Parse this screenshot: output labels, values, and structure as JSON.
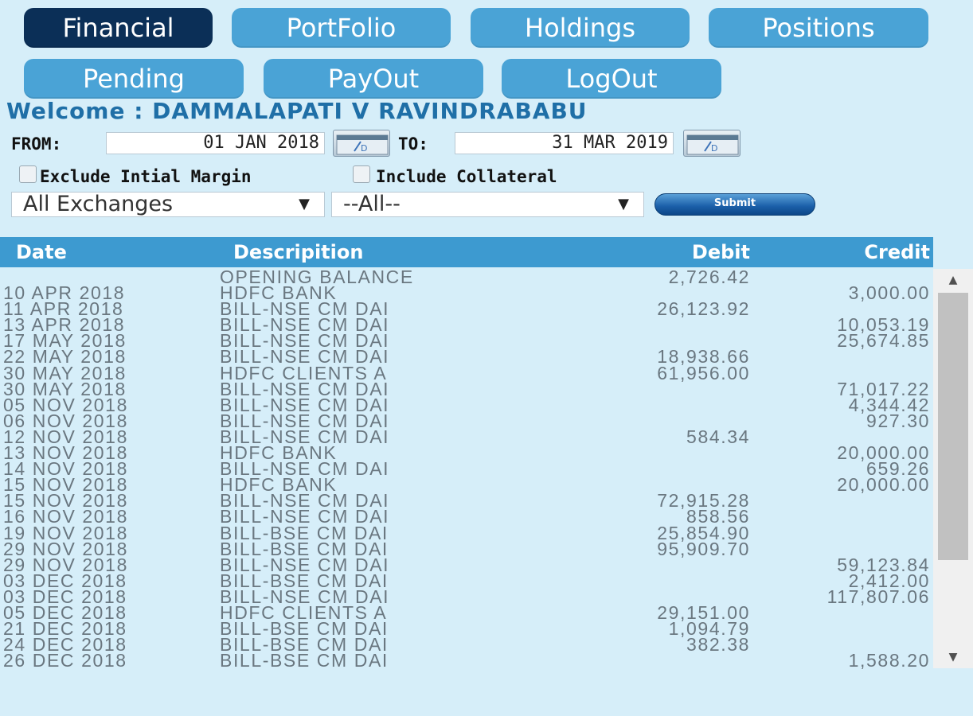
{
  "nav": {
    "financial": "Financial",
    "portfolio": "PortFolio",
    "holdings": "Holdings",
    "positions": "Positions",
    "pending": "Pending",
    "payout": "PayOut",
    "logout": "LogOut"
  },
  "welcome": "Welcome : DAMMALAPATI V RAVINDRABABU",
  "filters": {
    "from_label": "FROM:",
    "from_value": "01 JAN 2018",
    "to_label": "TO:",
    "to_value": "31 MAR 2019",
    "exclude_margin": "Exclude Intial Margin",
    "include_collateral": "Include Collateral",
    "exchange_select": "All Exchanges",
    "segment_select": "--All--",
    "submit": "Submit"
  },
  "table": {
    "headers": {
      "date": "Date",
      "description": "Descripition",
      "debit": "Debit",
      "credit": "Credit"
    },
    "rows": [
      {
        "date": "",
        "desc": "OPENING BALANCE",
        "debit": "2,726.42",
        "credit": ""
      },
      {
        "date": "10 APR 2018",
        "desc": "HDFC BANK",
        "debit": "",
        "credit": "3,000.00"
      },
      {
        "date": "11 APR 2018",
        "desc": "BILL-NSE CM DAI",
        "debit": "26,123.92",
        "credit": ""
      },
      {
        "date": "13 APR 2018",
        "desc": "BILL-NSE CM DAI",
        "debit": "",
        "credit": "10,053.19"
      },
      {
        "date": "17 MAY 2018",
        "desc": "BILL-NSE CM DAI",
        "debit": "",
        "credit": "25,674.85"
      },
      {
        "date": "22 MAY 2018",
        "desc": "BILL-NSE CM DAI",
        "debit": "18,938.66",
        "credit": ""
      },
      {
        "date": "30 MAY 2018",
        "desc": "HDFC CLIENTS A",
        "debit": "61,956.00",
        "credit": ""
      },
      {
        "date": "30 MAY 2018",
        "desc": "BILL-NSE CM DAI",
        "debit": "",
        "credit": "71,017.22"
      },
      {
        "date": "05 NOV 2018",
        "desc": "BILL-NSE CM DAI",
        "debit": "",
        "credit": "4,344.42"
      },
      {
        "date": "06 NOV 2018",
        "desc": "BILL-NSE CM DAI",
        "debit": "",
        "credit": "927.30"
      },
      {
        "date": "12 NOV 2018",
        "desc": "BILL-NSE CM DAI",
        "debit": "584.34",
        "credit": ""
      },
      {
        "date": "13 NOV 2018",
        "desc": "HDFC BANK",
        "debit": "",
        "credit": "20,000.00"
      },
      {
        "date": "14 NOV 2018",
        "desc": "BILL-NSE CM DAI",
        "debit": "",
        "credit": "659.26"
      },
      {
        "date": "15 NOV 2018",
        "desc": "HDFC BANK",
        "debit": "",
        "credit": "20,000.00"
      },
      {
        "date": "15 NOV 2018",
        "desc": "BILL-NSE CM DAI",
        "debit": "72,915.28",
        "credit": ""
      },
      {
        "date": "16 NOV 2018",
        "desc": "BILL-NSE CM DAI",
        "debit": "858.56",
        "credit": ""
      },
      {
        "date": "19 NOV 2018",
        "desc": "BILL-BSE CM DAI",
        "debit": "25,854.90",
        "credit": ""
      },
      {
        "date": "29 NOV 2018",
        "desc": "BILL-BSE CM DAI",
        "debit": "95,909.70",
        "credit": ""
      },
      {
        "date": "29 NOV 2018",
        "desc": "BILL-NSE CM DAI",
        "debit": "",
        "credit": "59,123.84"
      },
      {
        "date": "03 DEC 2018",
        "desc": "BILL-BSE CM DAI",
        "debit": "",
        "credit": "2,412.00"
      },
      {
        "date": "03 DEC 2018",
        "desc": "BILL-NSE CM DAI",
        "debit": "",
        "credit": "117,807.06"
      },
      {
        "date": "05 DEC 2018",
        "desc": "HDFC CLIENTS A",
        "debit": "29,151.00",
        "credit": ""
      },
      {
        "date": "21 DEC 2018",
        "desc": "BILL-BSE CM DAI",
        "debit": "1,094.79",
        "credit": ""
      },
      {
        "date": "24 DEC 2018",
        "desc": "BILL-BSE CM DAI",
        "debit": "382.38",
        "credit": ""
      },
      {
        "date": "26 DEC 2018",
        "desc": "BILL-BSE CM DAI",
        "debit": "",
        "credit": "1,588.20"
      }
    ]
  },
  "icons": {
    "calendar": "calendar-icon",
    "dropdown": "chevron-down-icon",
    "scroll_up": "scroll-up-icon",
    "scroll_down": "scroll-down-icon"
  },
  "colors": {
    "background": "#d6eef9",
    "nav_button": "#4aa3d6",
    "nav_active": "#0b2f57",
    "header": "#3d9ad0",
    "welcome_text": "#1f6fa7"
  }
}
